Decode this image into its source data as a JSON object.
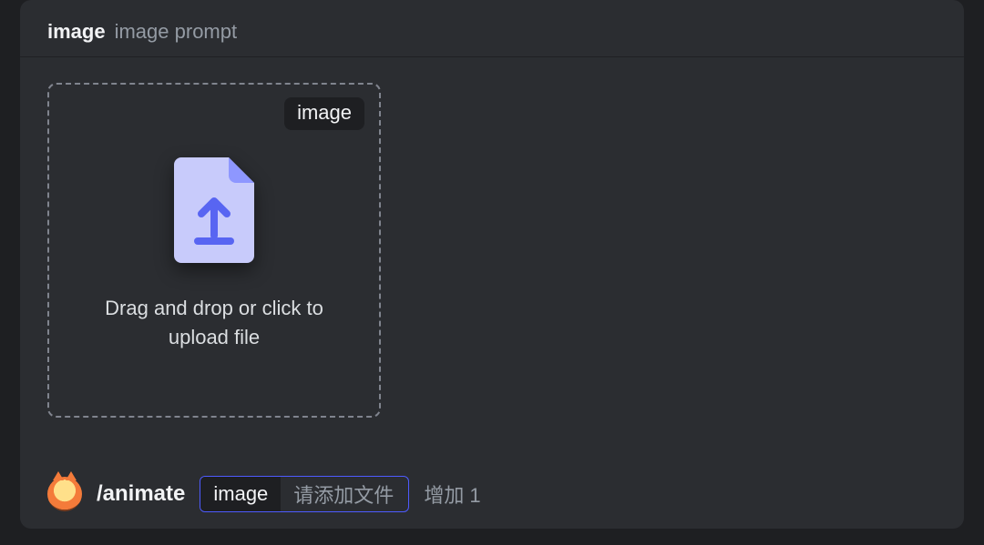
{
  "header": {
    "param_name": "image",
    "param_desc": "image prompt"
  },
  "dropzone": {
    "badge": "image",
    "hint": "Drag and drop or click to upload file"
  },
  "command_row": {
    "command": "/animate",
    "option": {
      "name": "image",
      "placeholder": "请添加文件"
    },
    "add_more": "增加 1"
  }
}
